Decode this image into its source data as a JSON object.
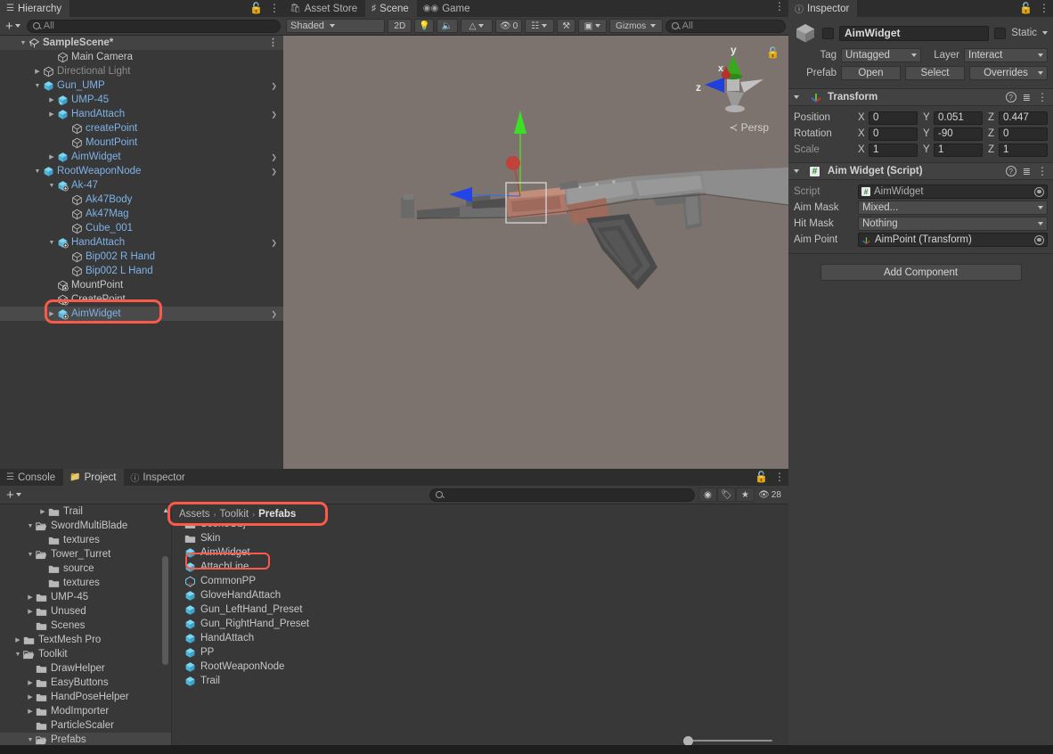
{
  "hierarchy": {
    "tab_label": "Hierarchy",
    "tab_icon": "hierarchy-icon",
    "search_placeholder": "All",
    "create_label": "+",
    "items": [
      {
        "label": "SampleScene*",
        "depth": 0,
        "icon": "scene-icon",
        "expand": "open",
        "color": "white",
        "kebab": true,
        "bold": true
      },
      {
        "label": "Main Camera",
        "depth": 2,
        "icon": "gameobject-icon",
        "expand": "none",
        "color": "white"
      },
      {
        "label": "Directional Light",
        "depth": 1,
        "icon": "gameobject-icon",
        "expand": "closed",
        "color": "dim"
      },
      {
        "label": "Gun_UMP",
        "depth": 1,
        "icon": "prefab-icon",
        "expand": "open",
        "color": "blue",
        "chevron": true
      },
      {
        "label": "UMP-45",
        "depth": 2,
        "icon": "prefab-variant-icon",
        "expand": "closed",
        "color": "blue"
      },
      {
        "label": "HandAttach",
        "depth": 2,
        "icon": "prefab-icon",
        "expand": "closed",
        "color": "blue",
        "chevron": true
      },
      {
        "label": "createPoint",
        "depth": 3,
        "icon": "gameobject-icon",
        "expand": "none",
        "color": "blue"
      },
      {
        "label": "MountPoint",
        "depth": 3,
        "icon": "gameobject-icon",
        "expand": "none",
        "color": "blue"
      },
      {
        "label": "AimWidget",
        "depth": 2,
        "icon": "prefab-icon",
        "expand": "closed",
        "color": "blue",
        "chevron": true
      },
      {
        "label": "RootWeaponNode",
        "depth": 1,
        "icon": "prefab-icon",
        "expand": "open",
        "color": "blue",
        "chevron": true
      },
      {
        "label": "Ak-47",
        "depth": 2,
        "icon": "prefab-add-icon",
        "expand": "open",
        "color": "blue"
      },
      {
        "label": "Ak47Body",
        "depth": 3,
        "icon": "gameobject-icon",
        "expand": "none",
        "color": "blue"
      },
      {
        "label": "Ak47Mag",
        "depth": 3,
        "icon": "gameobject-icon",
        "expand": "none",
        "color": "blue"
      },
      {
        "label": "Cube_001",
        "depth": 3,
        "icon": "gameobject-icon",
        "expand": "none",
        "color": "blue"
      },
      {
        "label": "HandAttach",
        "depth": 2,
        "icon": "prefab-add-icon",
        "expand": "open",
        "color": "blue",
        "chevron": true
      },
      {
        "label": "Bip002 R Hand",
        "depth": 3,
        "icon": "gameobject-icon",
        "expand": "none",
        "color": "blue"
      },
      {
        "label": "Bip002 L Hand",
        "depth": 3,
        "icon": "gameobject-icon",
        "expand": "none",
        "color": "blue"
      },
      {
        "label": "MountPoint",
        "depth": 2,
        "icon": "gameobject-add-icon",
        "expand": "none",
        "color": "white"
      },
      {
        "label": "CreatePoint",
        "depth": 2,
        "icon": "gameobject-add-icon",
        "expand": "none",
        "color": "white"
      },
      {
        "label": "AimWidget",
        "depth": 2,
        "icon": "prefab-add-icon",
        "expand": "closed",
        "color": "blue",
        "chevron": true,
        "selected": true,
        "highlight": true
      }
    ]
  },
  "scene": {
    "tabs": [
      {
        "label": "Asset Store",
        "icon": "asset-store-icon",
        "active": false
      },
      {
        "label": "Scene",
        "icon": "scene-grid-icon",
        "active": true
      },
      {
        "label": "Game",
        "icon": "game-pad-icon",
        "active": false
      }
    ],
    "shading_mode": "Shaded",
    "mode_2d": "2D",
    "light_toggle": "light-bulb-icon",
    "audio_toggle": "audio-icon",
    "fx_dropdown": "effects-icon",
    "hidden_count": "0",
    "grid_icon": "grid-icon",
    "tool_icon": "tools-icon",
    "camera_icon": "camera-icon",
    "gizmos_label": "Gizmos",
    "search_placeholder": "All",
    "perspective_label": "Persp",
    "gizmo_axes": {
      "x": "x",
      "y": "y",
      "z": "z"
    }
  },
  "inspector": {
    "tab_label": "Inspector",
    "tab_icon": "info-icon",
    "object_name": "AimWidget",
    "static_label": "Static",
    "tag_label": "Tag",
    "tag_value": "Untagged",
    "layer_label": "Layer",
    "layer_value": "Interact",
    "prefab_label": "Prefab",
    "prefab_open": "Open",
    "prefab_select": "Select",
    "prefab_overrides": "Overrides",
    "transform": {
      "title": "Transform",
      "icon": "transform-icon",
      "rows": [
        {
          "label": "Position",
          "x": "0",
          "y": "0.051",
          "z": "0.447"
        },
        {
          "label": "Rotation",
          "x": "0",
          "y": "-90",
          "z": "0"
        },
        {
          "label": "Scale",
          "x": "1",
          "y": "1",
          "z": "1",
          "dim": true
        }
      ],
      "axis_labels": [
        "X",
        "Y",
        "Z"
      ]
    },
    "script_component": {
      "title": "Aim Widget (Script)",
      "icon": "script-icon",
      "fields": [
        {
          "label": "Script",
          "value": "AimWidget",
          "type": "object",
          "icon": "script-icon",
          "dim": true
        },
        {
          "label": "Aim Mask",
          "value": "Mixed...",
          "type": "dropdown"
        },
        {
          "label": "Hit Mask",
          "value": "Nothing",
          "type": "dropdown"
        },
        {
          "label": "Aim Point",
          "value": "AimPoint (Transform)",
          "type": "object",
          "icon": "transform-icon"
        }
      ]
    },
    "add_component": "Add Component"
  },
  "project": {
    "tabs": [
      {
        "label": "Console",
        "icon": "console-icon",
        "active": false
      },
      {
        "label": "Project",
        "icon": "folder-icon",
        "active": true
      },
      {
        "label": "Inspector",
        "icon": "info-icon",
        "active": false
      }
    ],
    "create_label": "+",
    "search_placeholder": "",
    "favorite_icon": "star-icon",
    "label_icon": "tag-icon",
    "type_icon": "type-icon",
    "hidden_icon": "hidden-eye-icon",
    "hidden_count": "28",
    "breadcrumb": [
      "Assets",
      "Toolkit",
      "Prefabs"
    ],
    "tree": [
      {
        "label": "Trail",
        "depth": 2,
        "expand": "closed",
        "icon": "folder"
      },
      {
        "label": "SwordMultiBlade",
        "depth": 1,
        "expand": "open",
        "icon": "folder-open"
      },
      {
        "label": "textures",
        "depth": 2,
        "expand": "none",
        "icon": "folder"
      },
      {
        "label": "Tower_Turret",
        "depth": 1,
        "expand": "open",
        "icon": "folder-open"
      },
      {
        "label": "source",
        "depth": 2,
        "expand": "none",
        "icon": "folder"
      },
      {
        "label": "textures",
        "depth": 2,
        "expand": "none",
        "icon": "folder"
      },
      {
        "label": "UMP-45",
        "depth": 1,
        "expand": "closed",
        "icon": "folder"
      },
      {
        "label": "Unused",
        "depth": 1,
        "expand": "closed",
        "icon": "folder"
      },
      {
        "label": "Scenes",
        "depth": 1,
        "expand": "none",
        "icon": "folder"
      },
      {
        "label": "TextMesh Pro",
        "depth": 0,
        "expand": "closed",
        "icon": "folder"
      },
      {
        "label": "Toolkit",
        "depth": 0,
        "expand": "open",
        "icon": "folder-open"
      },
      {
        "label": "DrawHelper",
        "depth": 1,
        "expand": "none",
        "icon": "folder"
      },
      {
        "label": "EasyButtons",
        "depth": 1,
        "expand": "closed",
        "icon": "folder"
      },
      {
        "label": "HandPoseHelper",
        "depth": 1,
        "expand": "closed",
        "icon": "folder"
      },
      {
        "label": "ModImporter",
        "depth": 1,
        "expand": "closed",
        "icon": "folder"
      },
      {
        "label": "ParticleScaler",
        "depth": 1,
        "expand": "none",
        "icon": "folder"
      },
      {
        "label": "Prefabs",
        "depth": 1,
        "expand": "open",
        "icon": "folder-open",
        "selected": true
      }
    ],
    "assets": [
      {
        "label": "SceneObj",
        "icon": "folder",
        "clipped": true
      },
      {
        "label": "Skin",
        "icon": "folder"
      },
      {
        "label": "AimWidget",
        "icon": "prefab",
        "highlight": true
      },
      {
        "label": "AttachLine",
        "icon": "prefab"
      },
      {
        "label": "CommonPP",
        "icon": "prefab-variant"
      },
      {
        "label": "GloveHandAttach",
        "icon": "prefab"
      },
      {
        "label": "Gun_LeftHand_Preset",
        "icon": "prefab"
      },
      {
        "label": "Gun_RightHand_Preset",
        "icon": "prefab"
      },
      {
        "label": "HandAttach",
        "icon": "prefab"
      },
      {
        "label": "PP",
        "icon": "prefab"
      },
      {
        "label": "RootWeaponNode",
        "icon": "prefab"
      },
      {
        "label": "Trail",
        "icon": "prefab"
      }
    ]
  },
  "colors": {
    "accent_blue": "#7eb2e8",
    "highlight_red": "#fb5a4b",
    "panel_bg": "#383838",
    "scene_bg": "#7c736e",
    "axis_x": "#d03030",
    "axis_y": "#5ad32a",
    "axis_z": "#2a5ad3"
  }
}
